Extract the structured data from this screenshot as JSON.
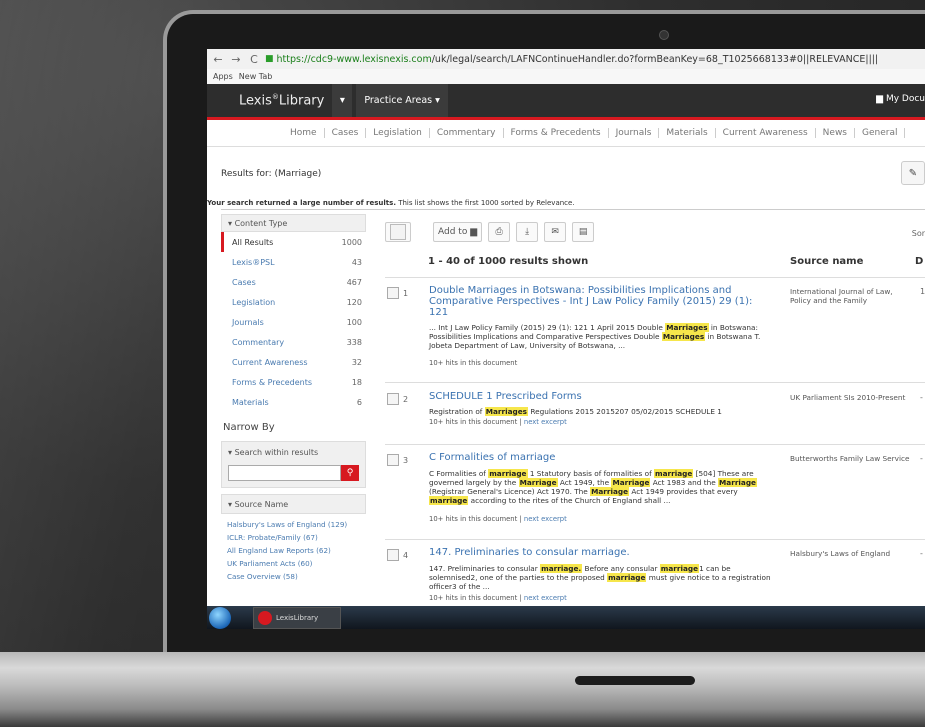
{
  "browser": {
    "nav": {
      "back": "←",
      "forward": "→",
      "reload": "C"
    },
    "url_host": "https://cdc9-www.lexisnexis.com",
    "url_path": "/uk/legal/search/LAFNContinueHandler.do?formBeanKey=68_T1025668133#0||RELEVANCE||||",
    "bookmarks": [
      "Apps",
      "New Tab"
    ]
  },
  "app": {
    "logo_main": "Lexis",
    "logo_sup": "®",
    "logo_tail": "Library",
    "practice_areas": "Practice Areas",
    "my_docs": "My Docu",
    "brand_red": "#d71920"
  },
  "topnav": [
    "Home",
    "Cases",
    "Legislation",
    "Commentary",
    "Forms & Precedents",
    "Journals",
    "Materials",
    "Current Awareness",
    "News",
    "General"
  ],
  "search": {
    "results_for": "Results for: (Marriage)",
    "notice_bold": "Your search returned a large number of results.",
    "notice_rest": " This list shows the first 1000 sorted by Relevance."
  },
  "sidebar": {
    "content_type_label": "Content Type",
    "facets": [
      {
        "label": "All Results",
        "count": "1000"
      },
      {
        "label": "Lexis®PSL",
        "count": "43"
      },
      {
        "label": "Cases",
        "count": "467"
      },
      {
        "label": "Legislation",
        "count": "120"
      },
      {
        "label": "Journals",
        "count": "100"
      },
      {
        "label": "Commentary",
        "count": "338"
      },
      {
        "label": "Current Awareness",
        "count": "32"
      },
      {
        "label": "Forms & Precedents",
        "count": "18"
      },
      {
        "label": "Materials",
        "count": "6"
      }
    ],
    "narrow_by": "Narrow By",
    "search_within": "Search within results",
    "source_name_label": "Source Name",
    "sources": [
      "Halsbury's Laws of England (129)",
      "ICLR: Probate/Family (67)",
      "All England Law Reports (62)",
      "UK Parliament Acts (60)",
      "Case Overview (58)"
    ]
  },
  "toolbar": {
    "add_to": "Add to",
    "sort": "Sor"
  },
  "results": {
    "summary": "1 - 40 of 1000 results shown",
    "source_col": "Source name",
    "col3": "D",
    "hits": "10+ hits in this document",
    "next_excerpt": "next excerpt",
    "items": [
      {
        "num": "1",
        "title": "Double Marriages in Botswana: Possibilities Implications and Comparative Perspectives - Int J Law Policy Family (2015) 29 (1): 121",
        "snippet_parts": [
          "... Int J Law Policy Family (2015) 29 (1): 121 1 April 2015 Double ",
          "Marriages",
          " in Botswana: Possibilities Implications and Comparative Perspectives Double ",
          "Marriages",
          " in Botswana T. Jobeta Department of Law, University of Botswana, ..."
        ],
        "source": "International Journal of Law, Policy and the Family",
        "date": "1"
      },
      {
        "num": "2",
        "title": "SCHEDULE 1 Prescribed Forms",
        "snippet_parts": [
          "Registration of ",
          "Marriages",
          " Regulations 2015 2015207 05/02/2015 SCHEDULE 1"
        ],
        "source": "UK Parliament SIs 2010-Present",
        "date": "-"
      },
      {
        "num": "3",
        "title": "C Formalities of marriage",
        "snippet_parts": [
          "C   Formalities of ",
          "marriage",
          " 1   Statutory basis of formalities of ",
          "marriage",
          " [504] These are governed largely by the ",
          "Marriage",
          " Act 1949, the ",
          "Marriage",
          " Act 1983 and the ",
          "Marriage",
          " (Registrar General's Licence) Act 1970. The ",
          "Marriage",
          " Act 1949 provides that every ",
          "marriage",
          " according to the rites of the Church of England shall ..."
        ],
        "source": "Butterworths Family Law Service",
        "date": "-"
      },
      {
        "num": "4",
        "title": "147. Preliminaries to consular marriage.",
        "snippet_parts": [
          "147. Preliminaries to consular ",
          "marriage.",
          " Before any consular ",
          "marriage",
          "1 can be solemnised2, one of the parties to the proposed ",
          "marriage",
          " must give notice to a registration officer3 of the ..."
        ],
        "source": "Halsbury's Laws of England",
        "date": "-"
      }
    ]
  },
  "taskbar": {
    "task_label": "LexisLibrary"
  }
}
